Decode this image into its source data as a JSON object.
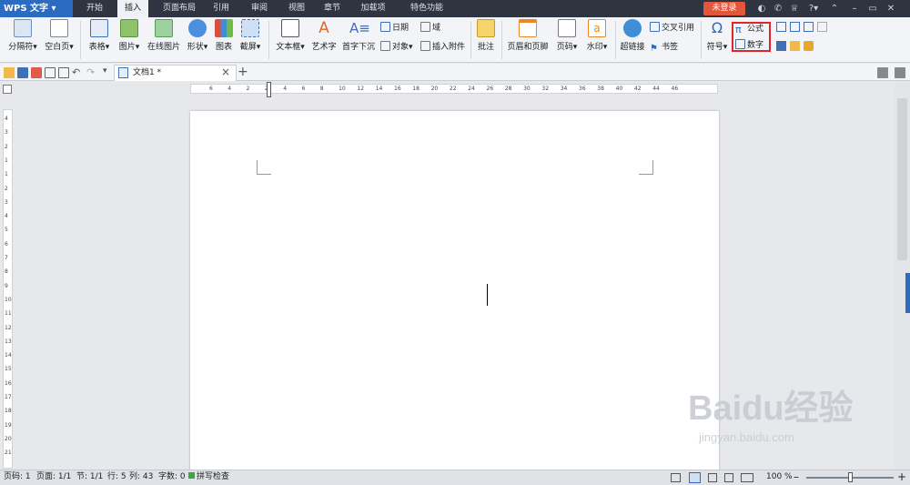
{
  "app": {
    "title": "WPS 文字"
  },
  "menu": [
    "开始",
    "插入",
    "页面布局",
    "引用",
    "审阅",
    "视图",
    "章节",
    "加载项",
    "特色功能"
  ],
  "menu_active": "插入",
  "login": "未登录",
  "ribbon": {
    "page_break": "分隔符",
    "blank_page": "空白页",
    "table": "表格",
    "picture": "图片",
    "online_picture": "在线图片",
    "shape": "形状",
    "chart": "图表",
    "screenshot": "截屏",
    "textbox": "文本框",
    "wordart": "艺术字",
    "dropcap": "首字下沉",
    "date": "日期",
    "object": "对象",
    "field": "域",
    "attachment": "插入附件",
    "comment": "批注",
    "header_footer": "页眉和页脚",
    "page_number": "页码",
    "watermark": "水印",
    "hyperlink": "超链接",
    "crossref": "交叉引用",
    "bookmark": "书签",
    "symbol": "符号",
    "formula": "公式",
    "number": "数字"
  },
  "tab": {
    "doc_name": "文档1 *",
    "close": "×",
    "add": "+"
  },
  "ruler": {
    "h": [
      "6",
      "4",
      "2",
      "2",
      "4",
      "6",
      "8",
      "10",
      "12",
      "14",
      "16",
      "18",
      "20",
      "22",
      "24",
      "26",
      "28",
      "30",
      "32",
      "34",
      "36",
      "38",
      "40",
      "42",
      "44",
      "46"
    ],
    "v": [
      "4",
      "3",
      "2",
      "1",
      "1",
      "2",
      "3",
      "4",
      "5",
      "6",
      "7",
      "8",
      "9",
      "10",
      "11",
      "12",
      "13",
      "14",
      "15",
      "16",
      "17",
      "18",
      "19",
      "20",
      "21"
    ]
  },
  "status": {
    "page_no": "页码: 1",
    "pages": "页面: 1/1",
    "section": "节: 1/1",
    "row": "行: 5",
    "col": "列: 43",
    "words": "字数: 0",
    "spell": "拼写检查",
    "zoom": "100 %"
  },
  "watermark": {
    "brand": "Baidu经验",
    "url": "jingyan.baidu.com"
  },
  "colors": {
    "accent": "#2b6bc1",
    "titlebar": "#2f3441",
    "highlight": "#e0262b",
    "login": "#e2573b"
  }
}
